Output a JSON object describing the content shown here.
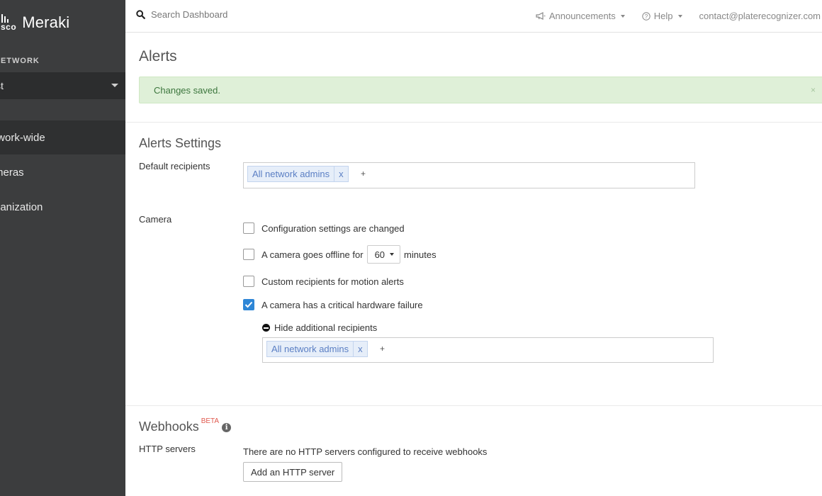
{
  "sidebar": {
    "logo_cisco": "cisco",
    "logo_meraki": "Meraki",
    "network_label": "NETWORK",
    "network_value": "st",
    "items": [
      {
        "label": "twork-wide"
      },
      {
        "label": "meras"
      },
      {
        "label": "ganization"
      }
    ]
  },
  "topbar": {
    "search_placeholder": "Search Dashboard",
    "announcements": "Announcements",
    "help": "Help",
    "account": "contact@platerecognizer.com"
  },
  "page": {
    "title": "Alerts",
    "alert_text": "Changes saved.",
    "alert_close": "×"
  },
  "settings": {
    "title": "Alerts Settings",
    "default_recipients_label": "Default recipients",
    "default_tag": "All network admins",
    "tag_remove": "x",
    "add": "+",
    "camera_label": "Camera",
    "options": [
      {
        "label": "Configuration settings are changed",
        "checked": false
      },
      {
        "label": "A camera goes offline for",
        "checked": false,
        "select_value": "60",
        "suffix": "minutes"
      },
      {
        "label": "Custom recipients for motion alerts",
        "checked": false
      },
      {
        "label": "A camera has a critical hardware failure",
        "checked": true
      }
    ],
    "hide_recipients": "Hide additional recipients",
    "extra_tag": "All network admins"
  },
  "webhooks": {
    "title": "Webhooks",
    "beta": "BETA",
    "info": "i",
    "http_label": "HTTP servers",
    "empty_text": "There are no HTTP servers configured to receive webhooks",
    "add_button": "Add an HTTP server"
  },
  "colors": {
    "sidebar_bg": "#3c3d3e",
    "success_bg": "#dff0d8",
    "success_text": "#3c763d",
    "accent": "#2e86d6",
    "tag_bg": "#e6eef9"
  }
}
